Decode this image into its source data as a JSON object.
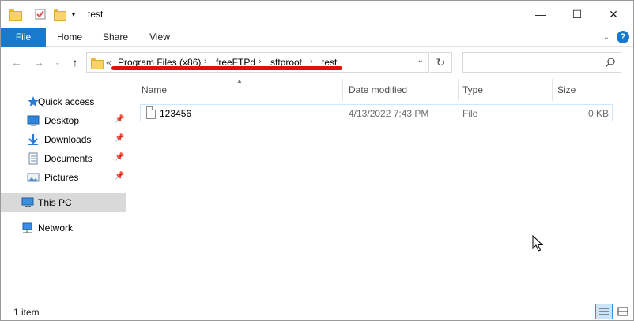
{
  "window": {
    "title": "test"
  },
  "ribbon": {
    "tabs": [
      "File",
      "Home",
      "Share",
      "View"
    ],
    "help": "?"
  },
  "address": {
    "overflow": "«",
    "crumbs": [
      "Program Files (x86)",
      "freeFTPd",
      "sftproot",
      "test"
    ],
    "separator": "›"
  },
  "search": {
    "placeholder": ""
  },
  "navpane": {
    "items": [
      {
        "label": "Quick access",
        "icon": "star-icon"
      },
      {
        "label": "Desktop",
        "icon": "desktop-icon",
        "pinned": true
      },
      {
        "label": "Downloads",
        "icon": "download-icon",
        "pinned": true
      },
      {
        "label": "Documents",
        "icon": "documents-icon",
        "pinned": true
      },
      {
        "label": "Pictures",
        "icon": "pictures-icon",
        "pinned": true
      },
      {
        "label": "This PC",
        "icon": "computer-icon",
        "selected": true
      },
      {
        "label": "Network",
        "icon": "network-icon"
      }
    ]
  },
  "columns": [
    "Name",
    "Date modified",
    "Type",
    "Size"
  ],
  "files": [
    {
      "name": "123456",
      "date": "4/13/2022 7:43 PM",
      "type": "File",
      "size": "0 KB"
    }
  ],
  "status": {
    "text": "1 item"
  },
  "colors": {
    "accent": "#1979ca",
    "selection": "#cce8ff",
    "annotation": "#e01010"
  }
}
